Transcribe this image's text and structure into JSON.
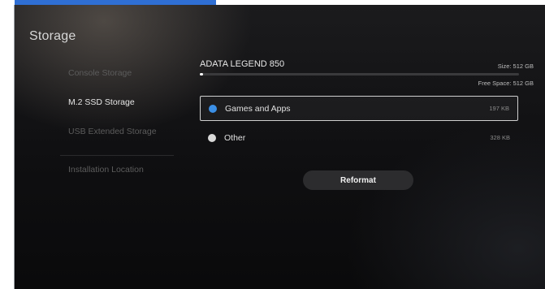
{
  "page": {
    "title": "Storage"
  },
  "nav": {
    "items": [
      {
        "label": "Console Storage",
        "active": false
      },
      {
        "label": "M.2 SSD Storage",
        "active": true
      },
      {
        "label": "USB Extended Storage",
        "active": false
      },
      {
        "label": "Installation Location",
        "active": false
      }
    ]
  },
  "device": {
    "name": "ADATA LEGEND 850",
    "size_text": "Size: 512 GB",
    "free_text": "Free Space: 512 GB",
    "used_fraction": 0.0
  },
  "categories": [
    {
      "label": "Games and Apps",
      "size": "197 KB",
      "color": "#3b8fe6",
      "selected": true
    },
    {
      "label": "Other",
      "size": "328 KB",
      "color": "#d9d9d9",
      "selected": false
    }
  ],
  "actions": {
    "reformat_label": "Reformat"
  },
  "colors": {
    "accent": "#2f6fd4"
  }
}
